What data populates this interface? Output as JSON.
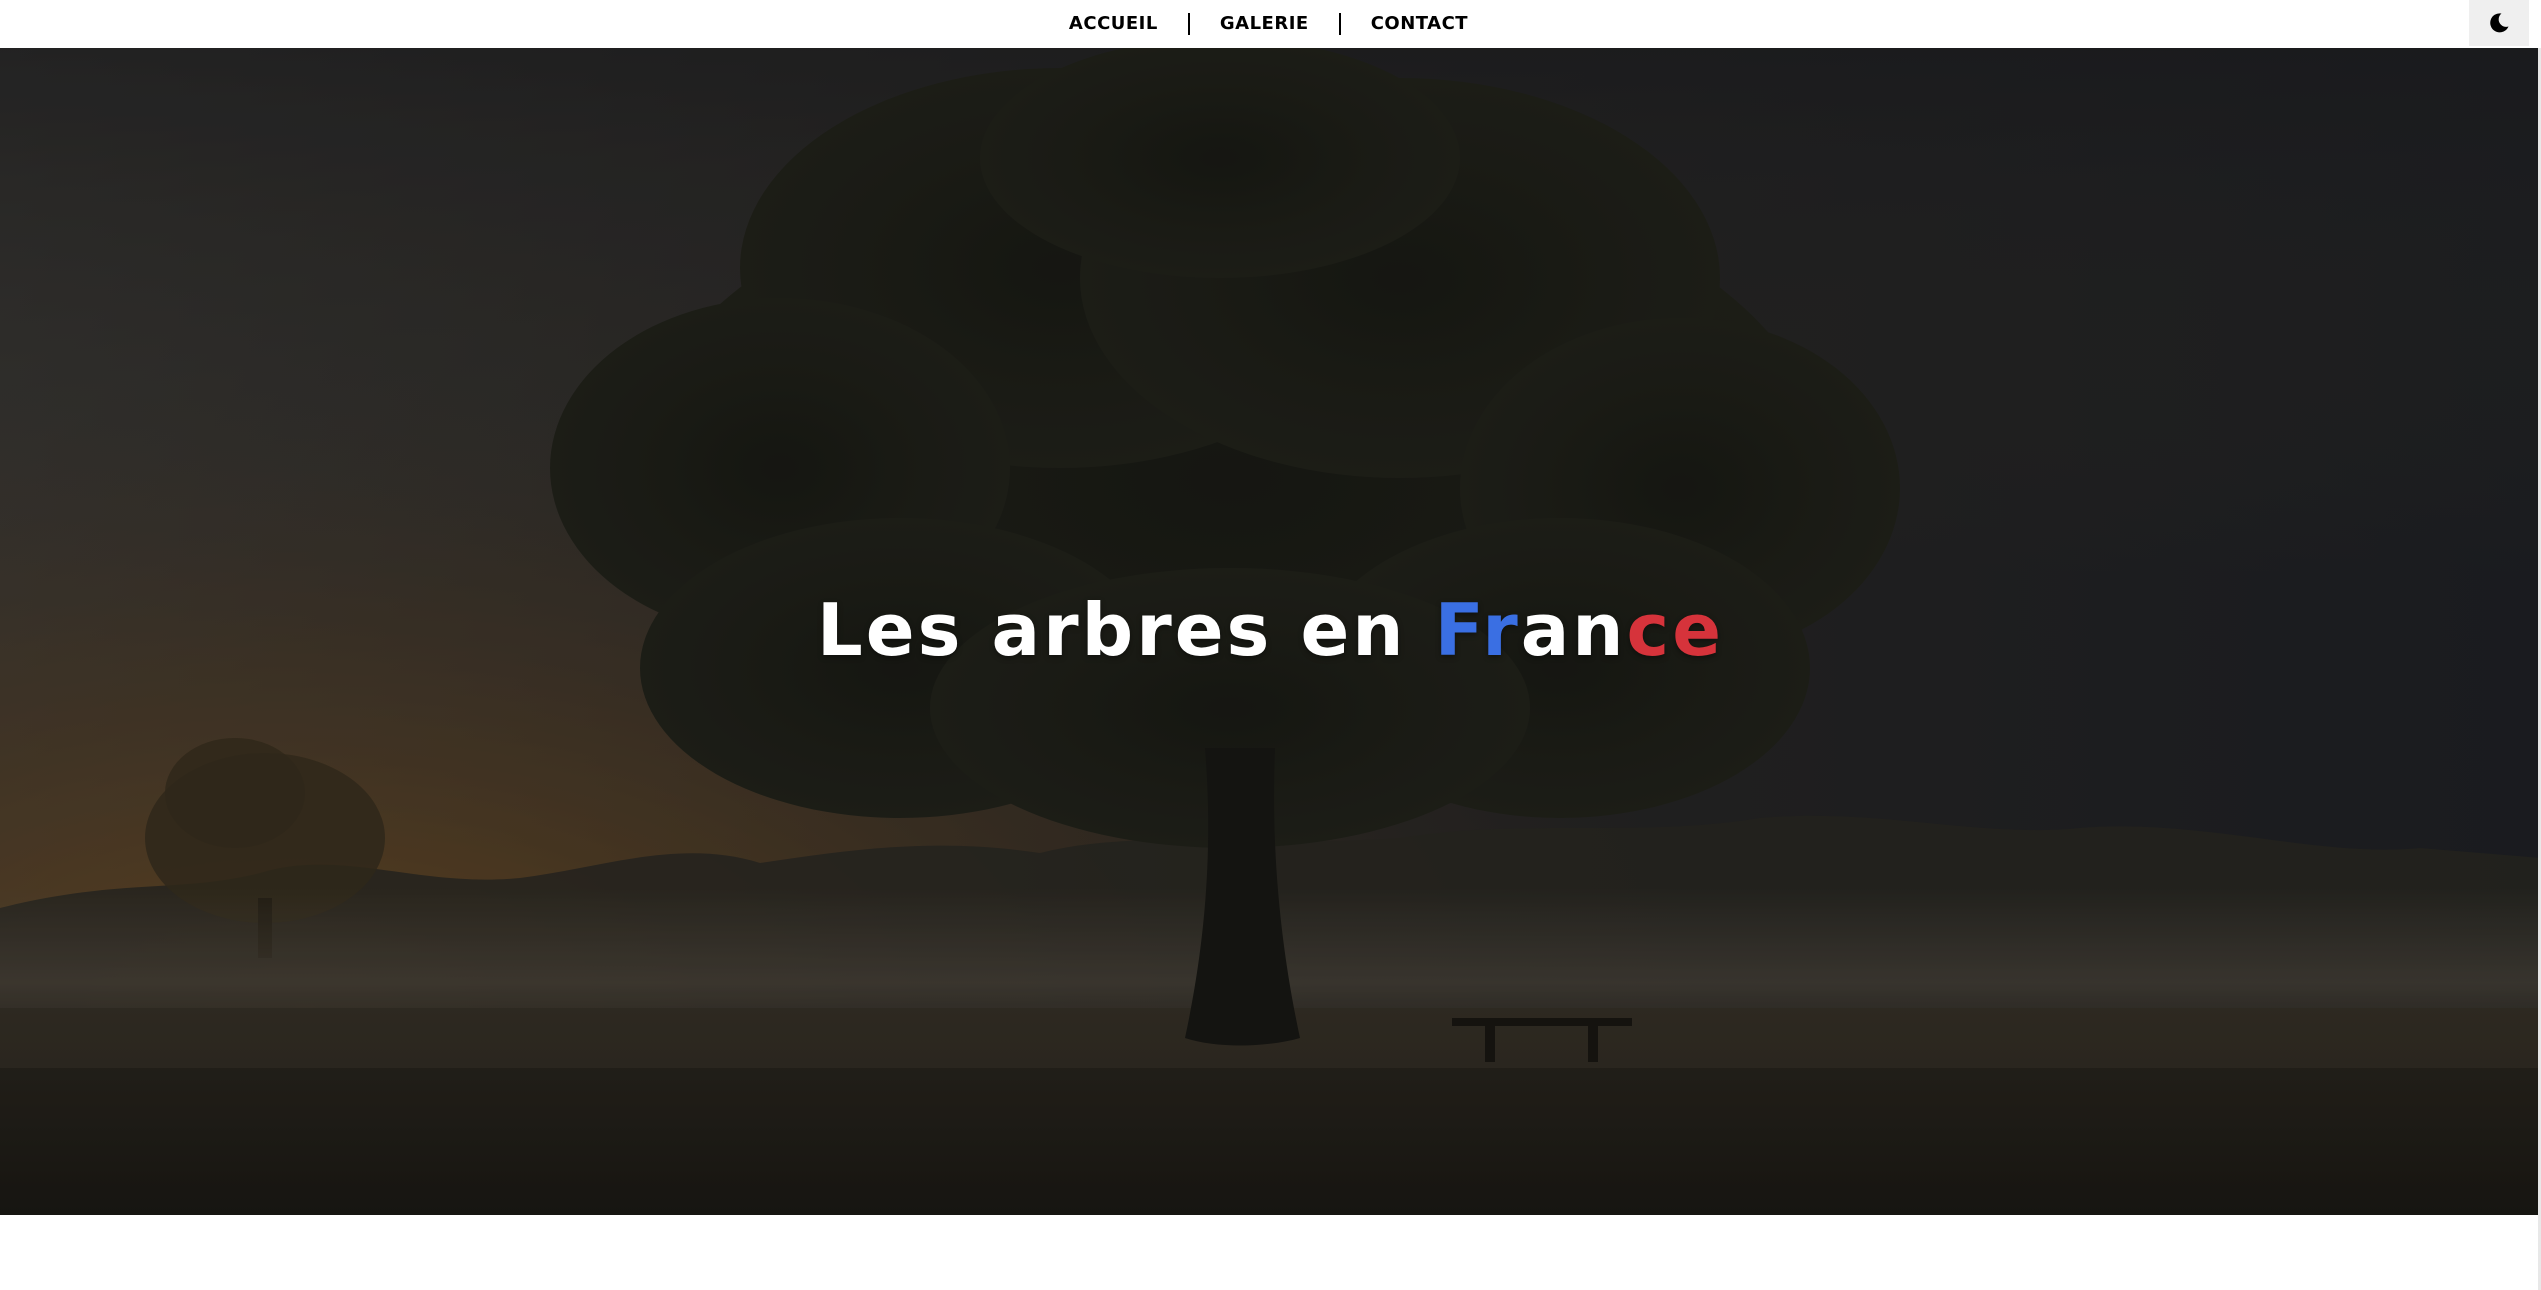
{
  "nav": {
    "items": [
      {
        "label": "ACCUEIL"
      },
      {
        "label": "GALERIE"
      },
      {
        "label": "CONTACT"
      }
    ],
    "theme_toggle_icon": "moon-icon"
  },
  "hero": {
    "title_prefix": "Les arbres en ",
    "title_part_blue": "Fr",
    "title_part_white": "an",
    "title_part_red": "ce",
    "colors": {
      "blue": "#3a6fe3",
      "white": "#ffffff",
      "red": "#d6333b"
    }
  }
}
